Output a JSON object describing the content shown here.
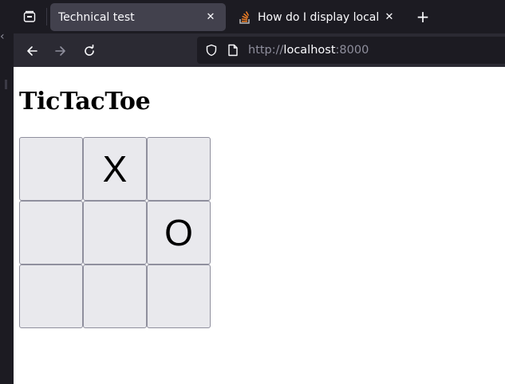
{
  "tabs": [
    {
      "title": "Technical test",
      "active": true
    },
    {
      "title": "How do I display local ima",
      "active": false
    }
  ],
  "address": {
    "protocol": "http://",
    "host": "localhost",
    "port": ":8000"
  },
  "page": {
    "heading": "TicTacToe"
  },
  "board": {
    "cells": [
      "",
      "X",
      "",
      "",
      "",
      "O",
      "",
      "",
      ""
    ]
  },
  "colors": {
    "chrome_dark": "#1c1b22",
    "navbar": "#2b2a33",
    "active_tab": "#42414d",
    "cell_bg": "#e9e9ed",
    "cell_border": "#8f8f9d",
    "stackoverflow_orange": "#f48024"
  },
  "icons": {
    "tab_manager": "tab-list-icon",
    "close": "close-icon",
    "new_tab": "plus-icon",
    "back": "back-arrow-icon",
    "forward": "forward-arrow-icon",
    "reload": "reload-icon",
    "shield": "tracking-shield-icon",
    "page": "page-icon"
  }
}
